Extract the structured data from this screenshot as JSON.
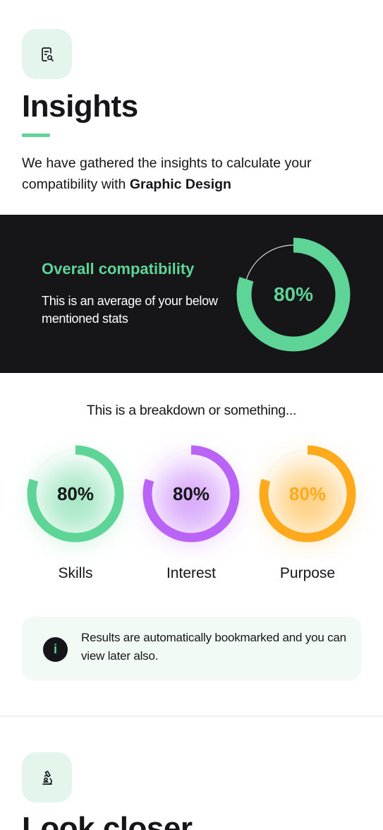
{
  "insights": {
    "icon": "document-search-icon",
    "title": "Insights",
    "intro_text": "We have gathered the insights to calculate your compatibility with ",
    "intro_highlight": "Graphic Design"
  },
  "overall": {
    "title": "Overall compatibility",
    "description": "This is an average of your below mentioned stats",
    "percent_label": "80%",
    "value": 0.8,
    "color": "#5ed497"
  },
  "breakdown": {
    "heading": "This is a breakdown or something...",
    "stats": [
      {
        "label": "Skills",
        "percent_label": "80%",
        "value": 0.8,
        "color": "#5ed497"
      },
      {
        "label": "Interest",
        "percent_label": "80%",
        "value": 0.8,
        "color": "#b964f7"
      },
      {
        "label": "Purpose",
        "percent_label": "80%",
        "value": 0.8,
        "color": "#ffaa1d"
      }
    ]
  },
  "info": {
    "icon": "info-icon",
    "icon_glyph": "i",
    "text": "Results are automatically bookmarked and you can view later also."
  },
  "look_closer": {
    "icon": "microscope-icon",
    "title": "Look closer"
  }
}
